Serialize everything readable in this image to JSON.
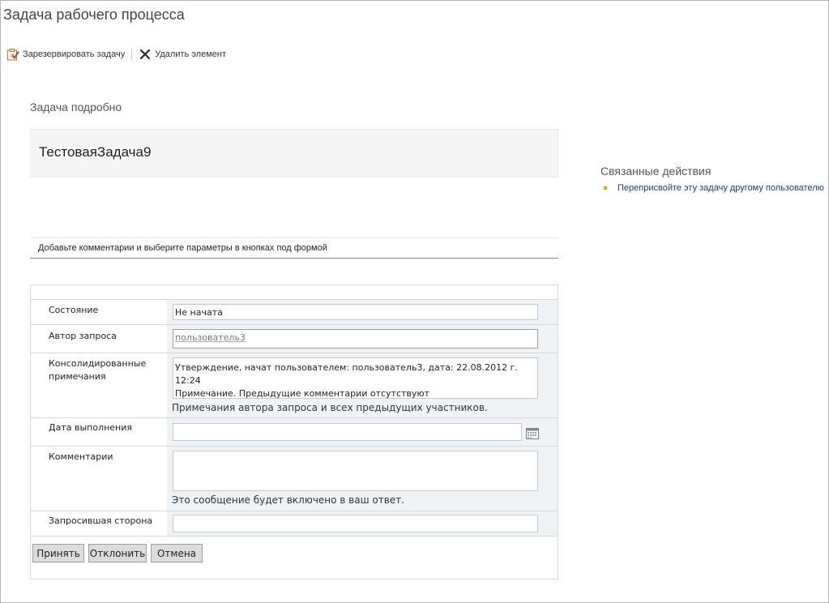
{
  "page": {
    "title": "Задача рабочего процесса"
  },
  "toolbar": {
    "reserve_label": "Зарезервировать задачу",
    "delete_label": "Удалить элемент",
    "reserve_icon": "task-checklist-icon",
    "delete_icon": "close-x-icon"
  },
  "details": {
    "section_title": "Задача подробно",
    "task_name": "ТестоваяЗадача9"
  },
  "form": {
    "instruction": "Добавьте комментарии и выберите параметры в кнопках под формой",
    "status": {
      "label": "Состояние",
      "value": "Не начата"
    },
    "requester": {
      "label": "Автор запроса",
      "value": "пользователь3"
    },
    "consolidated": {
      "label_line1": "Консолидированные",
      "label_line2": "примечания",
      "line1": "Утверждение, начат пользователем: пользователь3, дата: 22.08.2012 г. 12:24",
      "line2": "Примечание. Предыдущие комментарии отсутствуют",
      "hint": "Примечания автора запроса и всех предыдущих участников."
    },
    "due_date": {
      "label": "Дата выполнения",
      "value": "",
      "icon": "calendar-icon"
    },
    "comments": {
      "label": "Комментарии",
      "value": "",
      "hint": "Это сообщение будет включено в ваш ответ."
    },
    "requesting_party": {
      "label": "Запросившая сторона",
      "value": ""
    },
    "buttons": {
      "accept": "Принять",
      "reject": "Отклонить",
      "cancel": "Отмена"
    }
  },
  "related": {
    "title": "Связанные действия",
    "items": [
      {
        "label": "Переприсвойте эту задачу другому пользователю"
      }
    ]
  },
  "colors": {
    "link": "#1a3f78",
    "bullet": "#d8a900",
    "field_area": "#f0f3f5",
    "button_bg": "#dcdcdc"
  }
}
